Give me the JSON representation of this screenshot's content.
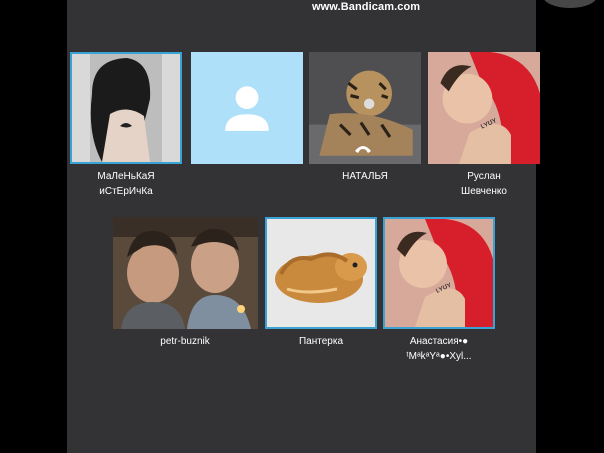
{
  "overlay": {
    "watermark": "www.Bandicam.com",
    "logo": "skype"
  },
  "contacts": [
    {
      "line1": "МаЛеНьКаЯ",
      "line2": "иСтЕрИчКа",
      "active": true
    },
    {
      "line1": "",
      "line2": "",
      "avatar": "default-user"
    },
    {
      "line1": "НАТАЛЬЯ",
      "line2": "",
      "status": "calling-phone"
    },
    {
      "line1": "Руслан",
      "line2": "Шевченко"
    },
    {
      "line1": "petr-buznik",
      "line2": ""
    },
    {
      "line1": "Пантерка",
      "line2": "",
      "active": true
    },
    {
      "line1": "Анастасия•●",
      "line2": "ᵗMᵃkᵃYᵃ●•Xyl...",
      "active": true
    }
  ],
  "colors": {
    "background": "#333336",
    "accent": "#39a3d6",
    "default_avatar": "#aee0f9"
  }
}
